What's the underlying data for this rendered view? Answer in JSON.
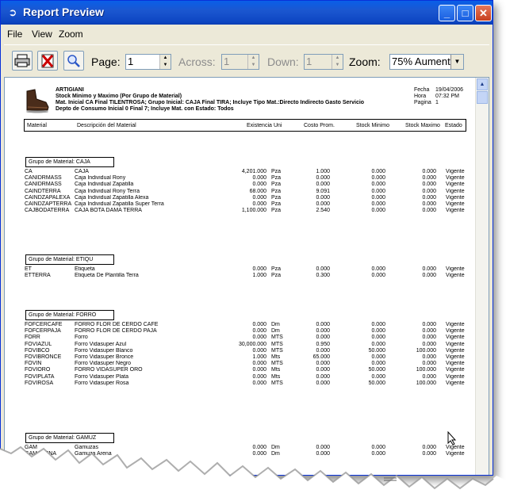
{
  "window": {
    "title": "Report Preview",
    "buttons": {
      "minimize": "_",
      "maximize": "□",
      "close": "✕"
    }
  },
  "menu": [
    "File",
    "View",
    "Zoom"
  ],
  "toolbar": {
    "page_label": "Page:",
    "page_value": "1",
    "across_label": "Across:",
    "across_value": "1",
    "down_label": "Down:",
    "down_value": "1",
    "zoom_label": "Zoom:",
    "zoom_value": "75% Aument"
  },
  "report": {
    "company": "ARTIGIANI",
    "title": "Stock Minimo y Maximo (Por Grupo de Material)",
    "filter1": "Mat. Inicial CA Final TILENTROSA;   Grupo Inicial: CAJA Final TIRA;    Incluye Tipo Mat.:Directo Indirecto Gasto Servicio",
    "filter2": "Depto de Consumo Inicial 0 Final 7;    Incluye Mat. con Estado: Todos",
    "fecha_label": "Fecha",
    "fecha_value": "19/04/2006",
    "hora_label": "Hora",
    "hora_value": "07:32 PM",
    "pagina_label": "Pagina",
    "pagina_value": "1",
    "columns": [
      "Material",
      "Descripción del Material",
      "Existencia",
      "Uni",
      "Costo Prom.",
      "Stock Minimo",
      "Stock Maximo",
      "Estado"
    ],
    "groups": [
      {
        "label": "Grupo de Material:   CAJA",
        "rows": [
          [
            "CA",
            "CAJA",
            "4,201.000",
            "Pza",
            "1.000",
            "0.000",
            "0.000",
            "Vigente"
          ],
          [
            "CANIDRMASS",
            "Caja Individual Rony",
            "0.000",
            "Pza",
            "0.000",
            "0.000",
            "0.000",
            "Vigente"
          ],
          [
            "CANIDRMASS",
            "Caja Individual Zapatilla",
            "0.000",
            "Pza",
            "0.000",
            "0.000",
            "0.000",
            "Vigente"
          ],
          [
            "CAINDTERRA",
            "Caja Individual Rony Terra",
            "68.000",
            "Pza",
            "9.091",
            "0.000",
            "0.000",
            "Vigente"
          ],
          [
            "CAINDZAPALEXA",
            "Caja Individual Zapatilla Alexa",
            "0.000",
            "Pza",
            "0.000",
            "0.000",
            "0.000",
            "Vigente"
          ],
          [
            "CAINDZAPTERRA",
            "Caja Individual Zapatilla Super Terra",
            "0.000",
            "Pza",
            "0.000",
            "0.000",
            "0.000",
            "Vigente"
          ],
          [
            "CAJBODATERRA",
            "CAJA BOTA DAMA TERRA",
            "1,100.000",
            "Pza",
            "2.540",
            "0.000",
            "0.000",
            "Vigente"
          ]
        ]
      },
      {
        "label": "Grupo de Material:   ETIQU",
        "rows": [
          [
            "ET",
            "Etiqueta",
            "0.000",
            "Pza",
            "0.000",
            "0.000",
            "0.000",
            "Vigente"
          ],
          [
            "ETTERRA",
            "Etiqueta De Plantilla Terra",
            "1.000",
            "Pza",
            "0.300",
            "0.000",
            "0.000",
            "Vigente"
          ]
        ]
      },
      {
        "label": "Grupo de Material:   FORRO",
        "rows": [
          [
            "FOFCERCAFE",
            "FORRO FLOR DE CERDO CAFE",
            "0.000",
            "Dm",
            "0.000",
            "0.000",
            "0.000",
            "Vigente"
          ],
          [
            "FOFCERPAJA",
            "FORRO FLOR DE CERDO PAJA",
            "0.000",
            "Dm",
            "0.000",
            "0.000",
            "0.000",
            "Vigente"
          ],
          [
            "FORR",
            "Forro",
            "0.000",
            "MTS",
            "0.000",
            "0.000",
            "0.000",
            "Vigente"
          ],
          [
            "FOVIAZUL",
            "Forro Vidasuper Azul",
            "30,000.000",
            "MTS",
            "0.950",
            "0.000",
            "0.000",
            "Vigente"
          ],
          [
            "FOVIBCO",
            "Forro Vidasuper Blanco",
            "0.000",
            "MTS",
            "0.000",
            "50.000",
            "100.000",
            "Vigente"
          ],
          [
            "FOVIBRONCE",
            "Forro Vidasuper Bronce",
            "1.000",
            "Mts",
            "65.000",
            "0.000",
            "0.000",
            "Vigente"
          ],
          [
            "FOVIN",
            "Forro Vidasuper Negro",
            "0.000",
            "MTS",
            "0.000",
            "0.000",
            "0.000",
            "Vigente"
          ],
          [
            "FOVIORO",
            "FORRO VIDASUPER ORO",
            "0.000",
            "Mts",
            "0.000",
            "50.000",
            "100.000",
            "Vigente"
          ],
          [
            "FOVIPLATA",
            "Forro Vidasuper Plata",
            "0.000",
            "Mts",
            "0.000",
            "0.000",
            "0.000",
            "Vigente"
          ],
          [
            "FOVIROSA",
            "Forro Vidasuper Rosa",
            "0.000",
            "MTS",
            "0.000",
            "50.000",
            "100.000",
            "Vigente"
          ]
        ]
      },
      {
        "label": "Grupo de Material:   GAMUZ",
        "rows": [
          [
            "GAM",
            "Gamuzas",
            "0.000",
            "Dm",
            "0.000",
            "0.000",
            "0.000",
            "Vigente"
          ],
          [
            "GAMARENA",
            "Gamuza Arena",
            "0.000",
            "Dm",
            "0.000",
            "0.000",
            "0.000",
            "Vigente"
          ]
        ]
      }
    ]
  }
}
